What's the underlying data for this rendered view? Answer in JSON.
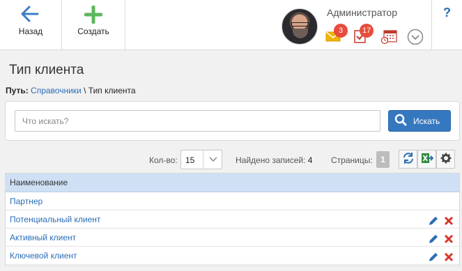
{
  "toolbar": {
    "back_label": "Назад",
    "create_label": "Создать"
  },
  "user": {
    "name": "Администратор",
    "mail_count": "3",
    "tasks_count": "17"
  },
  "help_label": "?",
  "page": {
    "title": "Тип клиента",
    "breadcrumb_prefix": "Путь:",
    "breadcrumb_link": "Справочники",
    "breadcrumb_separator": " \\ ",
    "breadcrumb_current": "Тип клиента"
  },
  "search": {
    "placeholder": "Что искать?",
    "value": "",
    "button_label": "Искать"
  },
  "list_controls": {
    "qty_label": "Кол-во:",
    "qty_value": "15",
    "found_label": "Найдено записей:",
    "found_count": "4",
    "pages_label": "Страницы:",
    "current_page": "1"
  },
  "grid": {
    "column_header": "Наименование",
    "rows": [
      {
        "name": "Партнер"
      },
      {
        "name": "Потенциальный клиент"
      },
      {
        "name": "Активный клиент"
      },
      {
        "name": "Ключевой клиент"
      }
    ]
  },
  "colors": {
    "accent_blue": "#3678c0",
    "link_blue": "#2a6db5",
    "create_green": "#5cb85c",
    "badge_red": "#e74c3c",
    "grid_header": "#cfe0f5"
  }
}
